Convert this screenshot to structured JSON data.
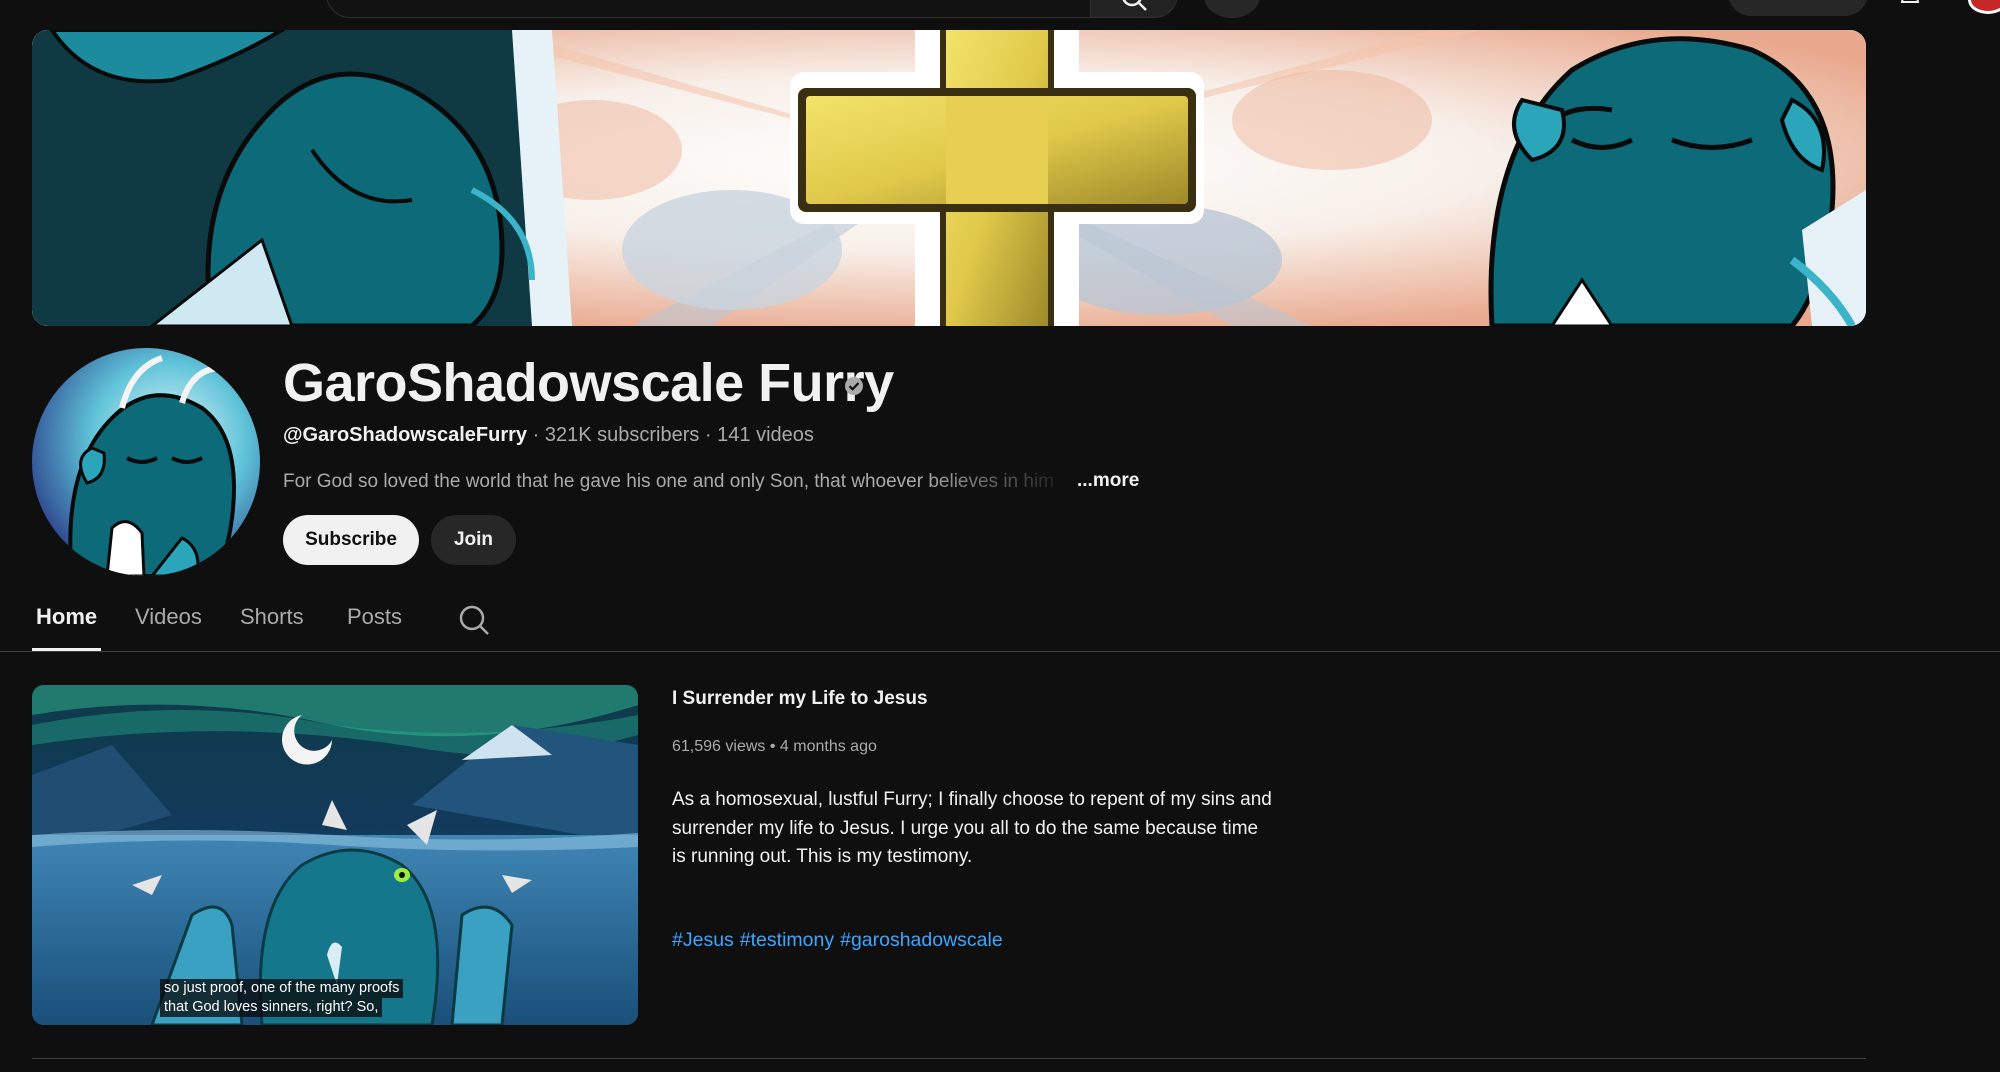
{
  "channel": {
    "name": "GaroShadowscale Furry",
    "handle": "@GaroShadowscaleFurry",
    "subscribers": "321K subscribers",
    "videos": "141 videos",
    "description": "For God so loved the world that he gave his one and only Son, that whoever believes in him",
    "more_label": "...more",
    "subscribe_label": "Subscribe",
    "join_label": "Join"
  },
  "tabs": [
    {
      "label": "Home",
      "active": true
    },
    {
      "label": "Videos",
      "active": false
    },
    {
      "label": "Shorts",
      "active": false
    },
    {
      "label": "Posts",
      "active": false
    }
  ],
  "featured_video": {
    "title": "I Surrender my Life to Jesus",
    "views": "61,596 views",
    "age": "4 months ago",
    "description": "As a homosexual, lustful Furry; I finally choose to repent of my sins and surrender my life to Jesus. I urge you all to do the same because time is running out. This is my testimony.",
    "hashtags": [
      "#Jesus",
      "#testimony",
      "#garoshadowscale"
    ],
    "caption_lines": [
      "so just proof, one of the many proofs",
      "that God loves sinners, right? So,"
    ]
  },
  "separator": "•",
  "meta_separator": "·",
  "colors": {
    "background": "#0f0f0f",
    "text_primary": "#f1f1f1",
    "text_secondary": "#aaaaaa",
    "link": "#3ea6ff",
    "dragon_teal": "#0d5e6e"
  },
  "icons": {
    "verified": "verified-check-icon",
    "tab_search": "search-icon",
    "top_search": "search-icon",
    "mic": "mic-icon",
    "notifications": "bell-icon"
  }
}
